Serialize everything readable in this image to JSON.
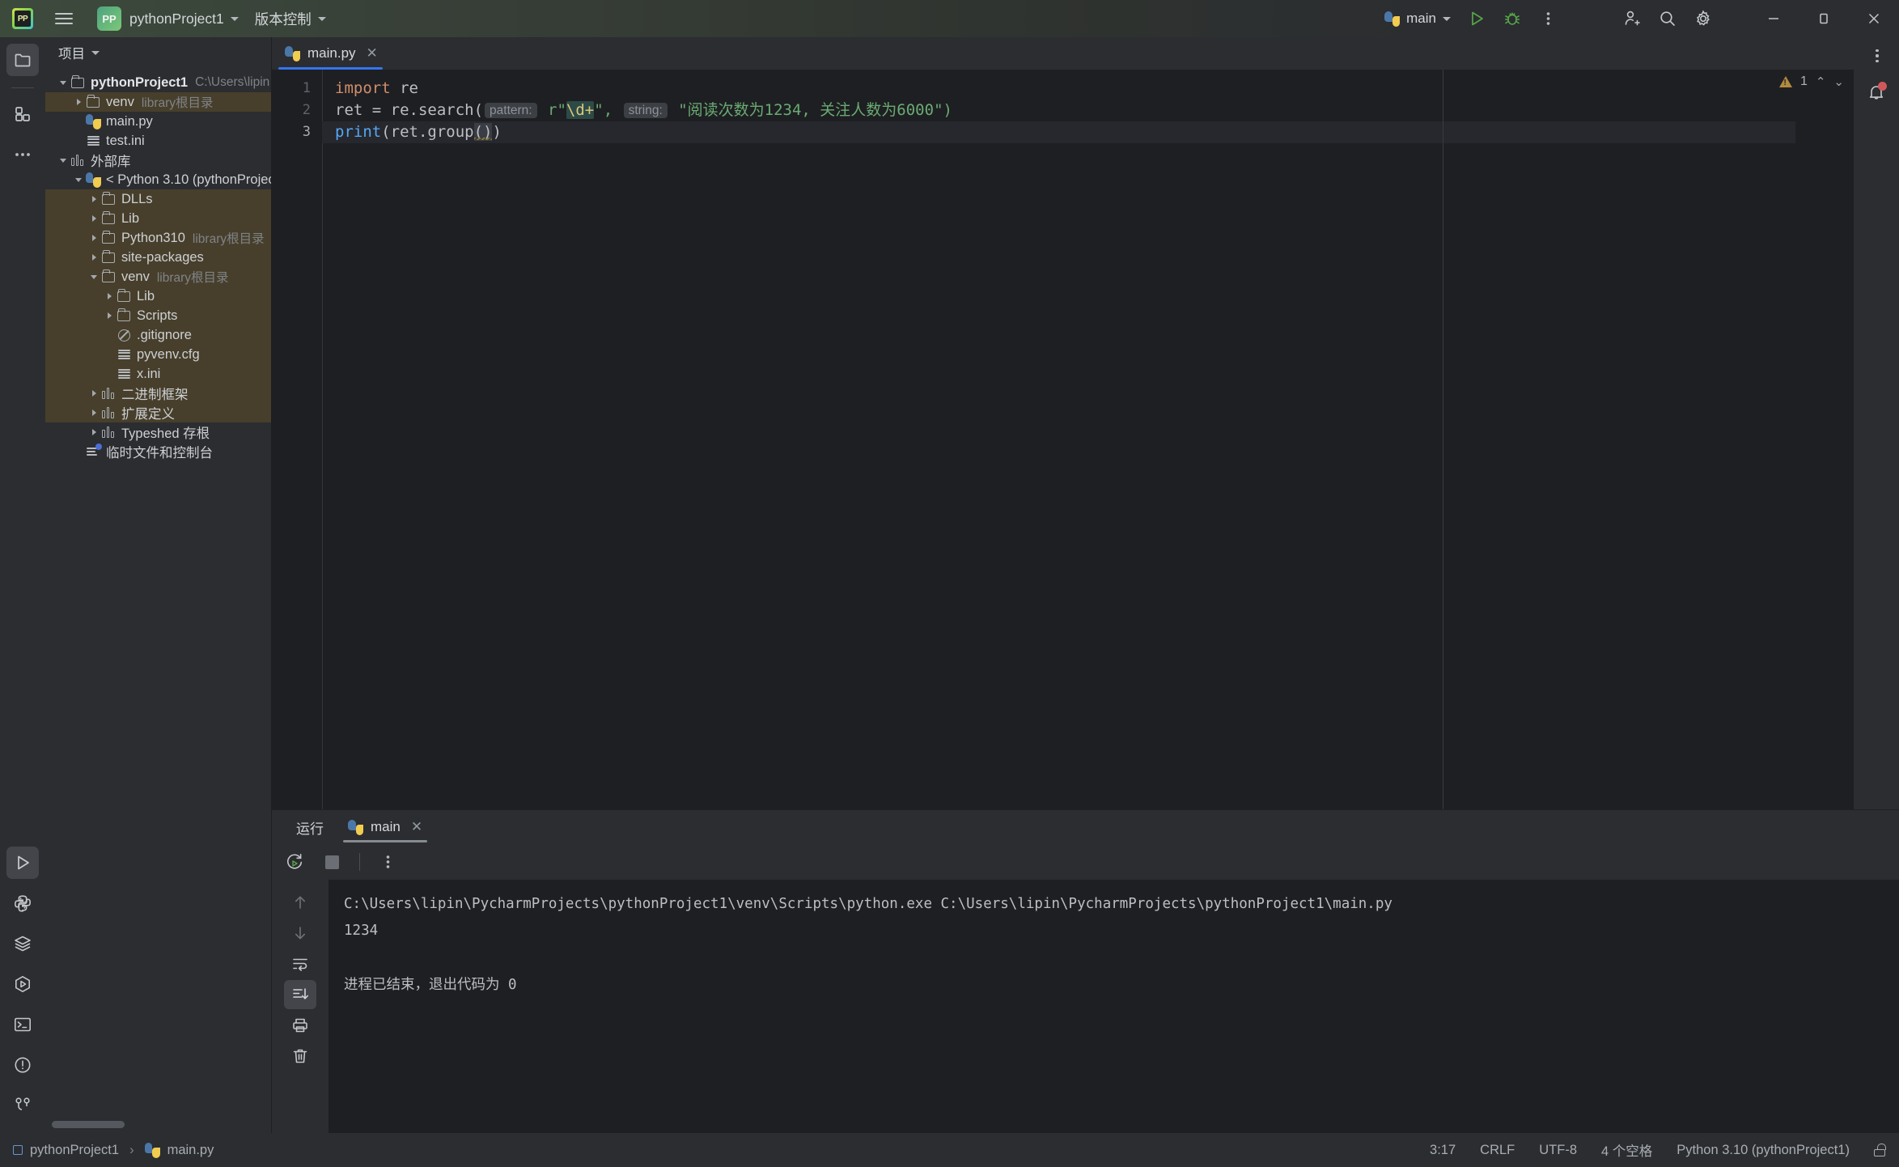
{
  "titlebar": {
    "logo_icon": "pycharm-logo-icon",
    "menu_icon": "hamburger-menu-icon",
    "project_badge": "PP",
    "project_name": "pythonProject1",
    "vcs_label": "版本控制",
    "run_config": "main",
    "run_icon": "run-icon",
    "debug_icon": "debug-icon",
    "more_icon": "more-options-icon",
    "account_icon": "add-account-icon",
    "search_icon": "search-icon",
    "settings_icon": "settings-gear-icon",
    "minimize_icon": "minimize-icon",
    "maximize_icon": "maximize-icon",
    "close_icon": "close-icon"
  },
  "left_strip": {
    "top": [
      {
        "name": "project-tool-window",
        "icon": "folder-icon",
        "active": true
      },
      {
        "name": "commit-tool-window",
        "icon": "structure-grid-icon",
        "active": false
      },
      {
        "name": "more-tool-windows",
        "icon": "ellipsis-icon",
        "active": false
      }
    ],
    "bottom": [
      {
        "name": "run-tool-window",
        "icon": "run-triangle-icon",
        "active": true
      },
      {
        "name": "python-packages-tool-window",
        "icon": "python-icon",
        "active": false
      },
      {
        "name": "database-tool-window",
        "icon": "layers-icon",
        "active": false
      },
      {
        "name": "services-tool-window",
        "icon": "hexagon-run-icon",
        "active": false
      },
      {
        "name": "terminal-tool-window",
        "icon": "terminal-icon",
        "active": false
      },
      {
        "name": "problems-tool-window",
        "icon": "warning-circle-icon",
        "active": false
      },
      {
        "name": "version-control-tool-window",
        "icon": "branch-icon",
        "active": false
      }
    ]
  },
  "project_panel": {
    "header": "项目",
    "tree": [
      {
        "depth": 0,
        "arrow": "down",
        "icon": "folder-icon",
        "label": "pythonProject1",
        "sub": "C:\\Users\\lipin",
        "bold": true,
        "highlight": false
      },
      {
        "depth": 1,
        "arrow": "right",
        "icon": "folder-icon",
        "label": "venv",
        "sub": "library根目录",
        "bold": false,
        "highlight": true
      },
      {
        "depth": 1,
        "arrow": "none",
        "icon": "python-icon",
        "label": "main.py",
        "sub": "",
        "bold": false,
        "highlight": false
      },
      {
        "depth": 1,
        "arrow": "none",
        "icon": "ini-icon",
        "label": "test.ini",
        "sub": "",
        "bold": false,
        "highlight": false
      },
      {
        "depth": 0,
        "arrow": "down",
        "icon": "library-icon",
        "label": "外部库",
        "sub": "",
        "bold": false,
        "highlight": false
      },
      {
        "depth": 1,
        "arrow": "down",
        "icon": "python-icon",
        "label": "< Python 3.10 (pythonProjec",
        "sub": "",
        "bold": false,
        "highlight": false
      },
      {
        "depth": 2,
        "arrow": "right",
        "icon": "folder-icon",
        "label": "DLLs",
        "sub": "",
        "bold": false,
        "highlight": true
      },
      {
        "depth": 2,
        "arrow": "right",
        "icon": "folder-icon",
        "label": "Lib",
        "sub": "",
        "bold": false,
        "highlight": true
      },
      {
        "depth": 2,
        "arrow": "right",
        "icon": "folder-icon",
        "label": "Python310",
        "sub": "library根目录",
        "bold": false,
        "highlight": true
      },
      {
        "depth": 2,
        "arrow": "right",
        "icon": "folder-icon",
        "label": "site-packages",
        "sub": "",
        "bold": false,
        "highlight": true
      },
      {
        "depth": 2,
        "arrow": "down",
        "icon": "folder-icon",
        "label": "venv",
        "sub": "library根目录",
        "bold": false,
        "highlight": true
      },
      {
        "depth": 3,
        "arrow": "right",
        "icon": "folder-icon",
        "label": "Lib",
        "sub": "",
        "bold": false,
        "highlight": true
      },
      {
        "depth": 3,
        "arrow": "right",
        "icon": "folder-icon",
        "label": "Scripts",
        "sub": "",
        "bold": false,
        "highlight": true
      },
      {
        "depth": 3,
        "arrow": "none",
        "icon": "gitignore-icon",
        "label": ".gitignore",
        "sub": "",
        "bold": false,
        "highlight": true
      },
      {
        "depth": 3,
        "arrow": "none",
        "icon": "ini-icon",
        "label": "pyvenv.cfg",
        "sub": "",
        "bold": false,
        "highlight": true
      },
      {
        "depth": 3,
        "arrow": "none",
        "icon": "ini-icon",
        "label": "x.ini",
        "sub": "",
        "bold": false,
        "highlight": true
      },
      {
        "depth": 2,
        "arrow": "right",
        "icon": "library-icon",
        "label": "二进制框架",
        "sub": "",
        "bold": false,
        "highlight": true
      },
      {
        "depth": 2,
        "arrow": "right",
        "icon": "library-icon",
        "label": "扩展定义",
        "sub": "",
        "bold": false,
        "highlight": true
      },
      {
        "depth": 2,
        "arrow": "right",
        "icon": "library-icon",
        "label": "Typeshed 存根",
        "sub": "",
        "bold": false,
        "highlight": false
      },
      {
        "depth": 1,
        "arrow": "none",
        "icon": "scratch-icon",
        "label": "临时文件和控制台",
        "sub": "",
        "bold": false,
        "highlight": false
      }
    ]
  },
  "editor": {
    "tab": {
      "label": "main.py",
      "icon": "python-icon",
      "close_icon": "close-icon"
    },
    "options_icon": "more-options-icon",
    "inspection": {
      "warning_count": "1",
      "warning_icon": "warning-triangle-icon",
      "prev_icon": "chevron-up-icon",
      "next_icon": "chevron-down-icon"
    },
    "notification_icon": "notification-bell-icon",
    "lines": [
      {
        "no": "1",
        "current": false
      },
      {
        "no": "2",
        "current": false
      },
      {
        "no": "3",
        "current": true
      }
    ],
    "code": {
      "l1_kw": "import",
      "l1_mod": " re",
      "l2_a": "ret = re.search(",
      "l2_hint1": "pattern:",
      "l2_pat_open": " r\"",
      "l2_pat_rx": "\\d+",
      "l2_pat_close": "\", ",
      "l2_hint2": "string:",
      "l2_str": " \"阅读次数为1234, 关注人数为6000\")",
      "l3_fn": "print",
      "l3_a": "(ret.group",
      "l3_b": "()",
      "l3_c": ")"
    }
  },
  "run_panel": {
    "title": "运行",
    "tab": {
      "label": "main",
      "icon": "python-icon",
      "close_icon": "close-icon"
    },
    "toolbar": {
      "rerun_icon": "rerun-icon",
      "stop_icon": "stop-icon",
      "more_icon": "more-options-icon"
    },
    "side_tools": [
      {
        "name": "scroll-up-button",
        "icon": "arrow-up-icon",
        "active": false
      },
      {
        "name": "scroll-down-button",
        "icon": "arrow-down-icon",
        "active": false
      },
      {
        "name": "soft-wrap-button",
        "icon": "wrap-text-icon",
        "active": false
      },
      {
        "name": "scroll-to-end-button",
        "icon": "scroll-to-end-icon",
        "active": true
      },
      {
        "name": "print-button",
        "icon": "print-icon",
        "active": false
      },
      {
        "name": "clear-all-button",
        "icon": "trash-icon",
        "active": false
      }
    ],
    "console": [
      "C:\\Users\\lipin\\PycharmProjects\\pythonProject1\\venv\\Scripts\\python.exe C:\\Users\\lipin\\PycharmProjects\\pythonProject1\\main.py",
      "1234",
      "",
      "进程已结束，退出代码为 0"
    ]
  },
  "statusbar": {
    "breadcrumb_project": "pythonProject1",
    "breadcrumb_sep": "›",
    "breadcrumb_file": "main.py",
    "caret": "3:17",
    "line_sep": "CRLF",
    "encoding": "UTF-8",
    "indent": "4 个空格",
    "interpreter": "Python 3.10 (pythonProject1)",
    "lock_icon": "unlocked-icon"
  },
  "colors": {
    "accent_blue": "#3574f0",
    "warning": "#b08b3e",
    "notification_badge": "#d1585a",
    "tree_highlight": "#473f2b",
    "editor_bg": "#1e1f22",
    "panel_bg": "#2b2d30"
  }
}
